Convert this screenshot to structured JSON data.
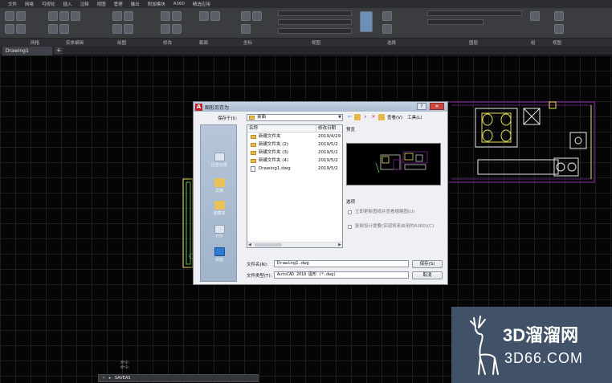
{
  "menu": [
    "文件",
    "网格",
    "可视化",
    "插入",
    "注释",
    "视图",
    "管理",
    "输出",
    "附加模块",
    "A360",
    "精选应用"
  ],
  "ribbon_panels": [
    "网格",
    "实体编辑",
    "绘图",
    "修改",
    "截面",
    "坐标",
    "视图",
    "选择",
    "图层",
    "组",
    "视图"
  ],
  "doc_tab": "Drawing1",
  "dialog": {
    "title": "图形另存为",
    "save_in_label": "保存于(I):",
    "save_in_value": "桌面",
    "toolbar": {
      "views_label": "查看(V)",
      "tools_label": "工具(L)"
    },
    "places": [
      "历史记录",
      "文档",
      "收藏夹",
      "FTP",
      "桌面"
    ],
    "columns": [
      "名称",
      "修改日期"
    ],
    "files": [
      {
        "name": "新建文件夹",
        "date": "2019/4/29",
        "type": "folder"
      },
      {
        "name": "新建文件夹 (2)",
        "date": "2019/5/2",
        "type": "folder"
      },
      {
        "name": "新建文件夹 (3)",
        "date": "2019/5/2",
        "type": "folder"
      },
      {
        "name": "新建文件夹 (4)",
        "date": "2019/5/2",
        "type": "folder"
      },
      {
        "name": "Drawing1.dwg",
        "date": "2019/5/2",
        "type": "dwg"
      }
    ],
    "preview_label": "预览",
    "options_label": "选项",
    "option1": "立即更新图纸并查看缩略图(U)",
    "option2": "复制设计提要(实现将来启用的A360)(C)",
    "filename_label": "文件名(N):",
    "filename_value": "Drawing1.dwg",
    "filetype_label": "文件类型(T):",
    "filetype_value": "AutoCAD 2018 图形 (*.dwg)",
    "save_button": "保存(S)",
    "cancel_button": "取消"
  },
  "command": {
    "history_1": "命令:",
    "history_2": "命令:",
    "prompt_close": "✕",
    "value": "SAVEAS"
  },
  "watermark": {
    "line1": "3D溜溜网",
    "line2": "3D66.COM"
  },
  "colors": {
    "cad_purple": "#7a2a8a",
    "cad_yellow": "#e8e05a",
    "cad_green": "#5ac85a",
    "cad_white": "#e8e8e8"
  }
}
